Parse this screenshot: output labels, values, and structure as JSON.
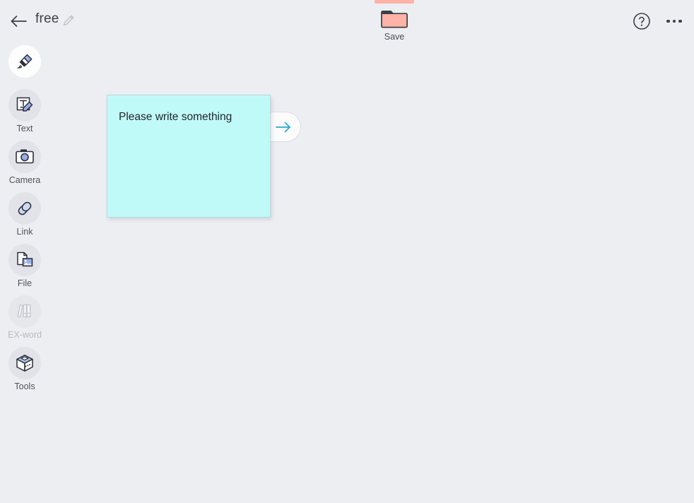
{
  "window": {
    "background_color": "#edeef2",
    "tab_accent_color": "#ffb3a7"
  },
  "header": {
    "back_icon": "arrow-left-icon",
    "title": "free",
    "title_edit_icon": "pencil-edit-icon",
    "save": {
      "label": "Save",
      "icon": "folder-icon",
      "icon_color": "#ffb3a7"
    },
    "help_icon": "question-circle-icon",
    "more_icon": "ellipsis-horizontal-icon"
  },
  "sidebar": {
    "items": [
      {
        "label": "",
        "icon": "pen-marker-icon",
        "state": "active"
      },
      {
        "label": "Text",
        "icon": "text-edit-icon",
        "state": "normal"
      },
      {
        "label": "Camera",
        "icon": "camera-icon",
        "state": "normal"
      },
      {
        "label": "Link",
        "icon": "link-chain-icon",
        "state": "normal"
      },
      {
        "label": "File",
        "icon": "file-image-icon",
        "state": "normal"
      },
      {
        "label": "EX-word",
        "icon": "books-icon",
        "state": "disabled"
      },
      {
        "label": "Tools",
        "icon": "toolbox-cube-icon",
        "state": "normal"
      }
    ]
  },
  "canvas": {
    "note": {
      "text": "Please write something",
      "background_color": "#bffaf9",
      "next_icon": "arrow-right-icon",
      "next_icon_color": "#27a9d4"
    }
  }
}
